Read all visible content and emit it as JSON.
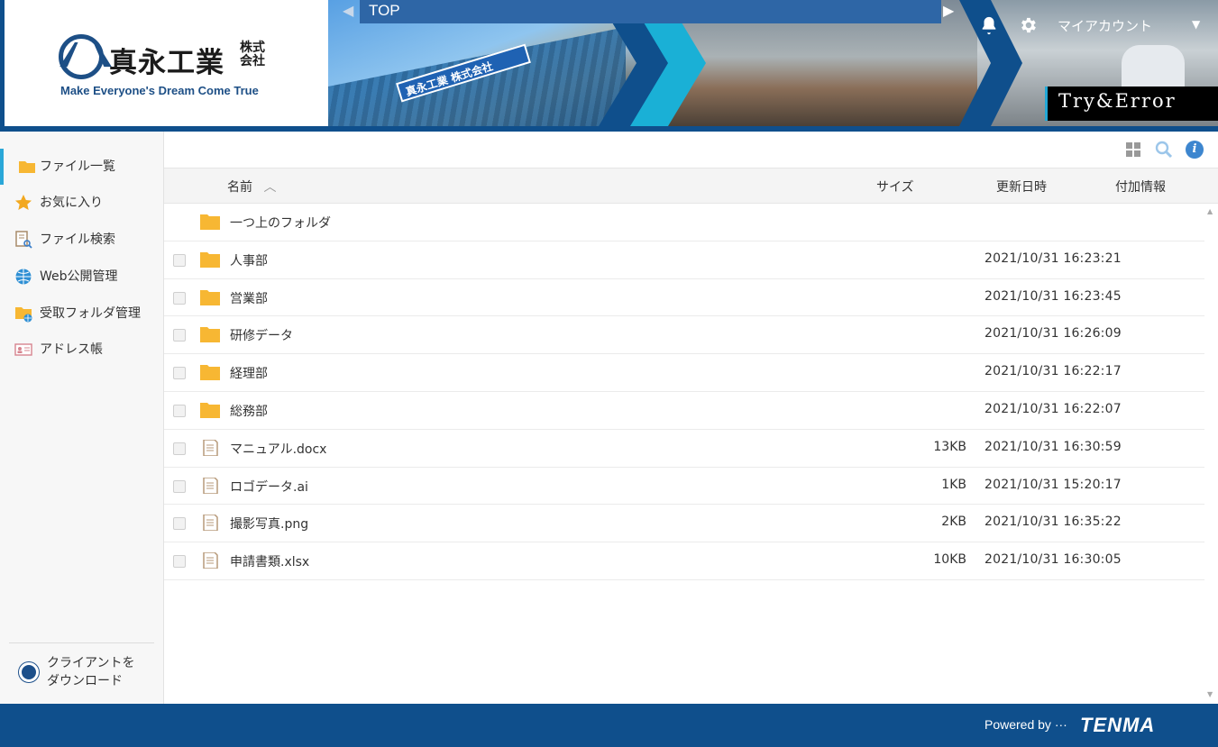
{
  "header": {
    "company_name": "真永工業",
    "company_corp": "株式会社",
    "tagline": "Make Everyone's Dream Come True",
    "banner_sign": "真永工業 株式会社",
    "banner_slogan": "Try&Error",
    "breadcrumb": "TOP",
    "account_label": "マイアカウント",
    "icons": [
      "bell-icon",
      "gear-icon",
      "chevron-down-icon"
    ],
    "brand_color": "#0f4f8c",
    "accent_color": "#1ab0d6"
  },
  "sidebar": {
    "items": [
      {
        "label": "ファイル一覧",
        "icon": "folder-icon",
        "active": true
      },
      {
        "label": "お気に入り",
        "icon": "star-icon"
      },
      {
        "label": "ファイル検索",
        "icon": "file-search-icon"
      },
      {
        "label": "Web公開管理",
        "icon": "globe-icon"
      },
      {
        "label": "受取フォルダ管理",
        "icon": "receive-folder-icon"
      },
      {
        "label": "アドレス帳",
        "icon": "address-card-icon"
      }
    ],
    "download_line1": "クライアントを",
    "download_line2": "ダウンロード"
  },
  "table": {
    "columns": {
      "name": "名前",
      "size": "サイズ",
      "modified": "更新日時",
      "extra": "付加情報"
    },
    "parent_folder": "一つ上のフォルダ",
    "rows": [
      {
        "type": "folder",
        "name": "人事部",
        "size": "",
        "modified": "2021/10/31 16:23:21"
      },
      {
        "type": "folder",
        "name": "営業部",
        "size": "",
        "modified": "2021/10/31 16:23:45"
      },
      {
        "type": "folder",
        "name": "研修データ",
        "size": "",
        "modified": "2021/10/31 16:26:09"
      },
      {
        "type": "folder",
        "name": "経理部",
        "size": "",
        "modified": "2021/10/31 16:22:17"
      },
      {
        "type": "folder",
        "name": "総務部",
        "size": "",
        "modified": "2021/10/31 16:22:07"
      },
      {
        "type": "file",
        "name": "マニュアル.docx",
        "size": "13KB",
        "modified": "2021/10/31 16:30:59"
      },
      {
        "type": "file",
        "name": "ロゴデータ.ai",
        "size": "1KB",
        "modified": "2021/10/31 15:20:17"
      },
      {
        "type": "file",
        "name": "撮影写真.png",
        "size": "2KB",
        "modified": "2021/10/31 16:35:22"
      },
      {
        "type": "file",
        "name": "申請書類.xlsx",
        "size": "10KB",
        "modified": "2021/10/31 16:30:05"
      }
    ]
  },
  "footer": {
    "powered_by": "Powered by ···",
    "brand": "TENMA"
  }
}
